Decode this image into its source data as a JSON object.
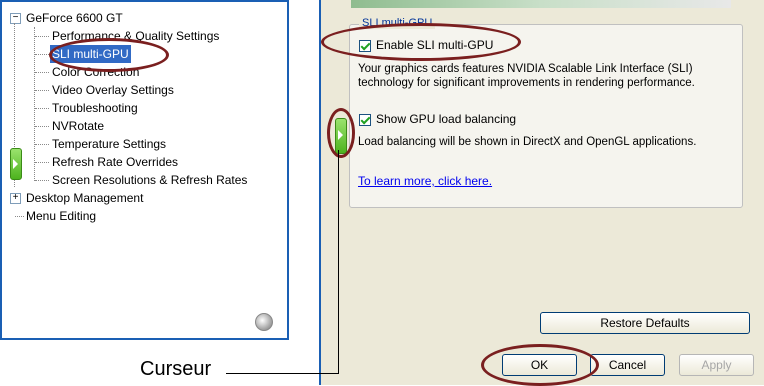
{
  "tree": {
    "root": "GeForce 6600 GT",
    "children": [
      "Performance & Quality Settings",
      "SLI multi-GPU",
      "Color Correction",
      "Video Overlay Settings",
      "Troubleshooting",
      "NVRotate",
      "Temperature Settings",
      "Refresh Rate Overrides",
      "Screen Resolutions & Refresh Rates"
    ],
    "desktop_management": "Desktop Management",
    "menu_editing": "Menu Editing",
    "selected": "SLI multi-GPU"
  },
  "group": {
    "title": "SLI multi-GPU",
    "enable_sli_label": "Enable SLI multi-GPU",
    "enable_sli_checked": true,
    "sli_description_1": "Your graphics cards features NVIDIA Scalable Link Interface (SLI)",
    "sli_description_2": "technology for significant improvements in rendering performance.",
    "show_load_label": "Show GPU load balancing",
    "show_load_checked": true,
    "load_description": "Load balancing will be shown in DirectX and OpenGL applications.",
    "learn_more_link": "To learn more, click here."
  },
  "buttons": {
    "restore_defaults": "Restore Defaults",
    "ok": "OK",
    "cancel": "Cancel",
    "apply": "Apply"
  },
  "callout": {
    "label": "Curseur"
  },
  "colors": {
    "selection": "#316ac5",
    "highlight_ellipse": "#7a1f1f",
    "frame_blue": "#1a5fb4",
    "panel_bg": "#ece9d8"
  }
}
